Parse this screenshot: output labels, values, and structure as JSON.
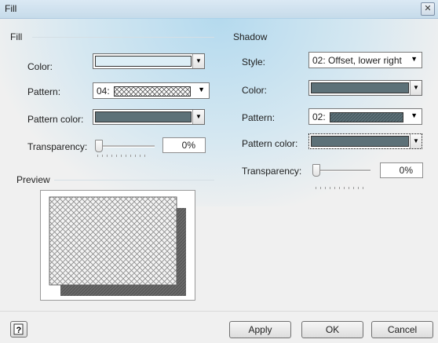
{
  "window": {
    "title": "Fill",
    "close_glyph": "✕"
  },
  "fill": {
    "section_title": "Fill",
    "color": {
      "label": "Color:",
      "swatch_color": "#ddeef6"
    },
    "pattern": {
      "label": "Pattern:",
      "value": "04:"
    },
    "pattern_color": {
      "label": "Pattern color:",
      "swatch_color": "#5d7178"
    },
    "transparency": {
      "label": "Transparency:",
      "value": "0%",
      "level": 0
    }
  },
  "shadow": {
    "section_title": "Shadow",
    "style": {
      "label": "Style:",
      "value": "02: Offset, lower right"
    },
    "color": {
      "label": "Color:",
      "swatch_color": "#5d7178"
    },
    "pattern": {
      "label": "Pattern:",
      "value": "02:"
    },
    "pattern_color": {
      "label": "Pattern color:",
      "swatch_color": "#5d7178"
    },
    "transparency": {
      "label": "Transparency:",
      "value": "0%",
      "level": 0
    }
  },
  "preview": {
    "section_title": "Preview"
  },
  "buttons": {
    "apply": "Apply",
    "ok": "OK",
    "cancel": "Cancel",
    "help_glyph": "?"
  },
  "icons": {
    "dropdown_arrow": "▼"
  }
}
